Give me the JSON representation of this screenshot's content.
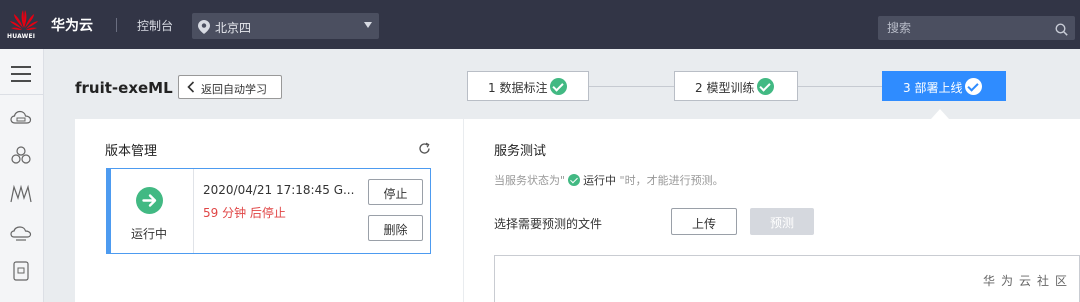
{
  "topbar": {
    "logo_text": "HUAWEI",
    "brand": "华为云",
    "console": "控制台",
    "region": "北京四",
    "search_placeholder": "搜索"
  },
  "header": {
    "title": "fruit-exeML",
    "back_label": "返回自动学习"
  },
  "steps": [
    {
      "label": "1 数据标注",
      "done": true
    },
    {
      "label": "2 模型训练",
      "done": true
    },
    {
      "label": "3 部署上线",
      "done": true,
      "active": true
    }
  ],
  "version_panel": {
    "title": "版本管理",
    "card": {
      "status": "运行中",
      "time": "2020/04/21 17:18:45 G...",
      "stop_notice": "59 分钟 后停止",
      "stop_label": "停止",
      "delete_label": "删除"
    }
  },
  "service_panel": {
    "title": "服务测试",
    "hint_prefix": "当服务状态为\"",
    "hint_status": "运行中",
    "hint_suffix": " \"时，才能进行预测。",
    "file_label": "选择需要预测的文件",
    "upload_label": "上传",
    "predict_label": "预测"
  },
  "watermark": "华为云社区",
  "colors": {
    "topbar": "#323546",
    "accent": "#2f8cff",
    "success": "#42b983",
    "danger": "#e04646"
  }
}
